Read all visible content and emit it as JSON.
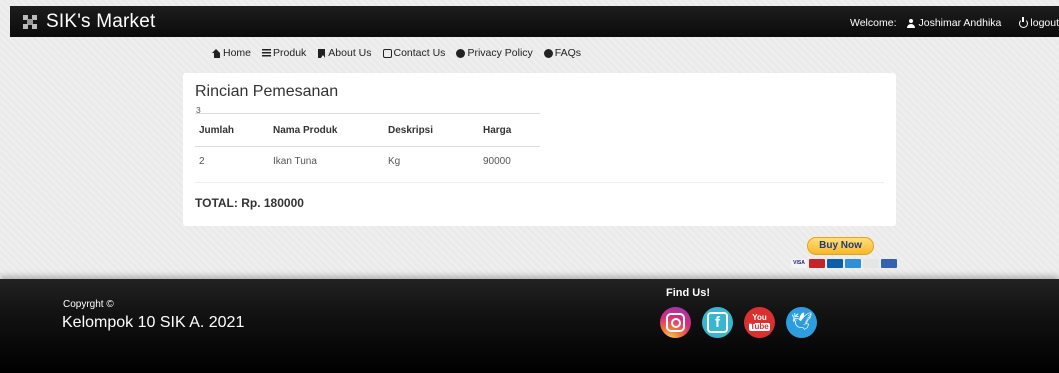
{
  "navbar": {
    "brand": "SIK's Market",
    "logo_icon": "market-logo-icon",
    "welcome_label": "Welcome:",
    "user_name": "Joshimar Andhika",
    "logout_label": "logout"
  },
  "menu": {
    "items": [
      {
        "label": "Home",
        "icon": "home-icon"
      },
      {
        "label": "Produk",
        "icon": "list-icon"
      },
      {
        "label": "About Us",
        "icon": "bookmark-icon"
      },
      {
        "label": "Contact Us",
        "icon": "contact-icon"
      },
      {
        "label": "Privacy Policy",
        "icon": "info-icon"
      },
      {
        "label": "FAQs",
        "icon": "question-icon"
      }
    ]
  },
  "order": {
    "title": "Rincian Pemesanan",
    "id": "3",
    "columns": [
      "Jumlah",
      "Nama Produk",
      "Deskripsi",
      "Harga"
    ],
    "rows": [
      [
        "2",
        "Ikan Tuna",
        "Kg",
        "90000"
      ]
    ],
    "total": "TOTAL: Rp. 180000"
  },
  "paypal": {
    "button_label": "Buy Now",
    "cards": [
      "VISA",
      "MC",
      "MAESTRO",
      "AMEX",
      "DISCOVER",
      "BANK"
    ]
  },
  "footer": {
    "copyright_label": "Copyrght ©",
    "copyright_text": "Kelompok 10 SIK A. 2021",
    "find_us": "Find Us!",
    "social": [
      "instagram-icon",
      "facebook-icon",
      "youtube-icon",
      "twitter-icon"
    ]
  },
  "colors": {
    "navbar_bg": "#111111",
    "buy_button": "#f7b72a",
    "instagram": "#d62d7c",
    "facebook": "#38b6d0",
    "youtube": "#d9312f",
    "twitter": "#2d9de0"
  }
}
